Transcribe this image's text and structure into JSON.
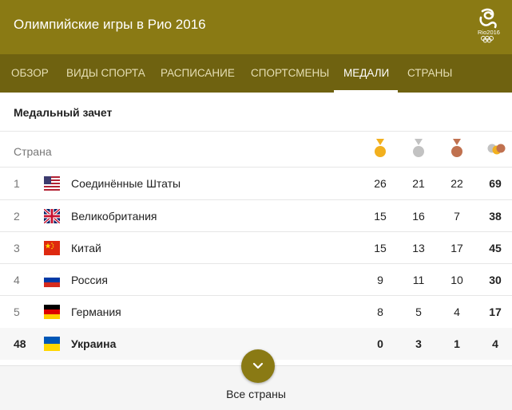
{
  "header": {
    "title": "Олимпийские игры в Рио 2016",
    "logo_icon": "rio-2016-logo-icon",
    "logo_text": "Rio2016"
  },
  "nav": {
    "tabs": [
      {
        "label": "ОБЗОР"
      },
      {
        "label": "ВИДЫ СПОРТА"
      },
      {
        "label": "РАСПИСАНИЕ"
      },
      {
        "label": "СПОРТСМЕНЫ"
      },
      {
        "label": "МЕДАЛИ"
      },
      {
        "label": "СТРАНЫ"
      }
    ],
    "active_tab": "МЕДАЛИ"
  },
  "medal_table": {
    "title": "Медальный зачет",
    "column_header": "Страна",
    "medal_icons": [
      "gold-medal-icon",
      "silver-medal-icon",
      "bronze-medal-icon",
      "total-medals-icon"
    ],
    "rows": [
      {
        "rank": "1",
        "flag": "usa-flag-icon",
        "country": "Соединённые Штаты",
        "gold": "26",
        "silver": "21",
        "bronze": "22",
        "total": "69"
      },
      {
        "rank": "2",
        "flag": "uk-flag-icon",
        "country": "Великобритания",
        "gold": "15",
        "silver": "16",
        "bronze": "7",
        "total": "38"
      },
      {
        "rank": "3",
        "flag": "china-flag-icon",
        "country": "Китай",
        "gold": "15",
        "silver": "13",
        "bronze": "17",
        "total": "45"
      },
      {
        "rank": "4",
        "flag": "russia-flag-icon",
        "country": "Россия",
        "gold": "9",
        "silver": "11",
        "bronze": "10",
        "total": "30"
      },
      {
        "rank": "5",
        "flag": "germany-flag-icon",
        "country": "Германия",
        "gold": "8",
        "silver": "5",
        "bronze": "4",
        "total": "17"
      },
      {
        "rank": "48",
        "flag": "ukraine-flag-icon",
        "country": "Украина",
        "gold": "0",
        "silver": "3",
        "bronze": "1",
        "total": "4"
      }
    ]
  },
  "footer": {
    "all_countries_label": "Все страны",
    "expand_icon": "chevron-down-icon"
  },
  "colors": {
    "header": "#8a7a14",
    "nav": "#6f6210",
    "gold": "#f2b01e",
    "silver": "#c2c2c2",
    "bronze": "#c0714f"
  }
}
